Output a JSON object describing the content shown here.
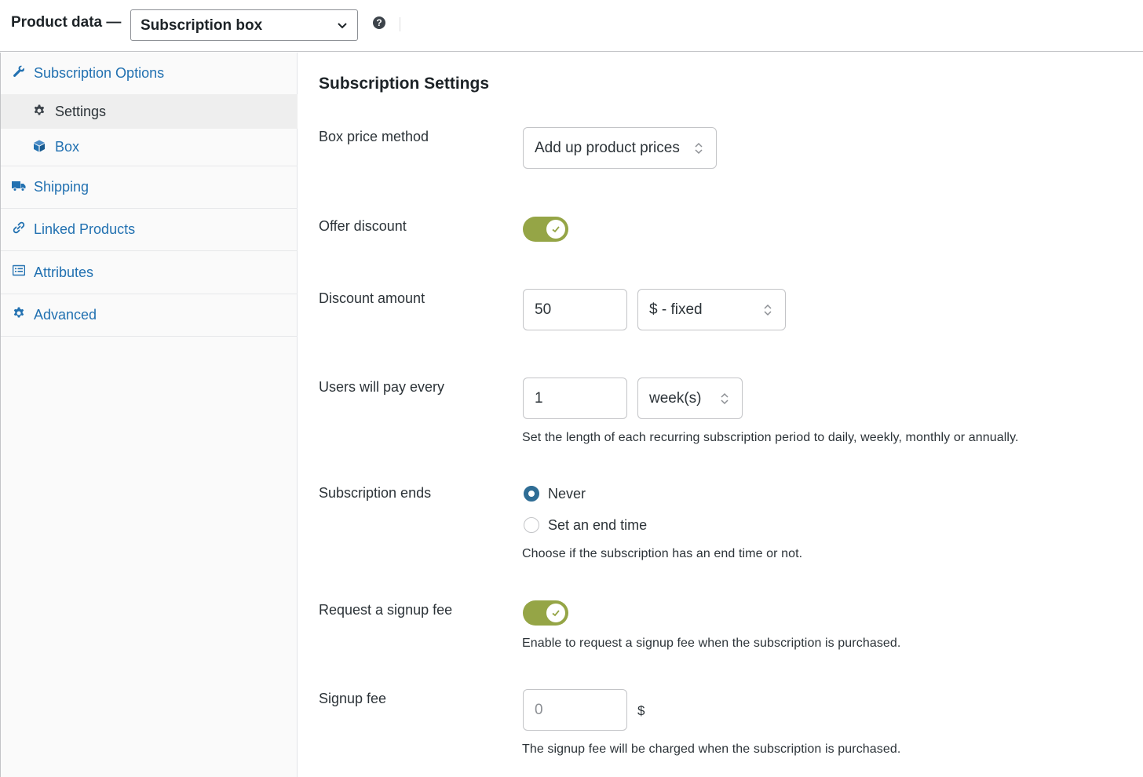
{
  "header": {
    "title": "Product data —",
    "product_type": "Subscription box"
  },
  "sidebar": {
    "items": [
      {
        "label": "Subscription Options",
        "icon": "wrench-icon"
      },
      {
        "label": "Settings",
        "icon": "gear-icon",
        "active": true
      },
      {
        "label": "Box",
        "icon": "cube-icon"
      },
      {
        "label": "Shipping",
        "icon": "truck-icon"
      },
      {
        "label": "Linked Products",
        "icon": "link-icon"
      },
      {
        "label": "Attributes",
        "icon": "list-icon"
      },
      {
        "label": "Advanced",
        "icon": "gear-icon"
      }
    ]
  },
  "settings": {
    "heading": "Subscription Settings",
    "box_price_method": {
      "label": "Box price method",
      "value": "Add up product prices"
    },
    "offer_discount": {
      "label": "Offer discount",
      "enabled": true
    },
    "discount_amount": {
      "label": "Discount amount",
      "value": "50",
      "type": "$ - fixed"
    },
    "pay_every": {
      "label": "Users will pay every",
      "value": "1",
      "period": "week(s)",
      "help": "Set the length of each recurring subscription period to daily, weekly, monthly or annually."
    },
    "subscription_ends": {
      "label": "Subscription ends",
      "options": [
        "Never",
        "Set an end time"
      ],
      "selected": "Never",
      "help": "Choose if the subscription has an end time or not."
    },
    "signup_fee_request": {
      "label": "Request a signup fee",
      "enabled": true,
      "help": "Enable to request a signup fee when the subscription is purchased."
    },
    "signup_fee": {
      "label": "Signup fee",
      "placeholder": "0",
      "currency": "$",
      "help": "The signup fee will be charged when the subscription is purchased."
    }
  },
  "colors": {
    "accent_blue": "#2271b1",
    "toggle_green": "#95a546",
    "radio_selected": "#2f6d95"
  }
}
